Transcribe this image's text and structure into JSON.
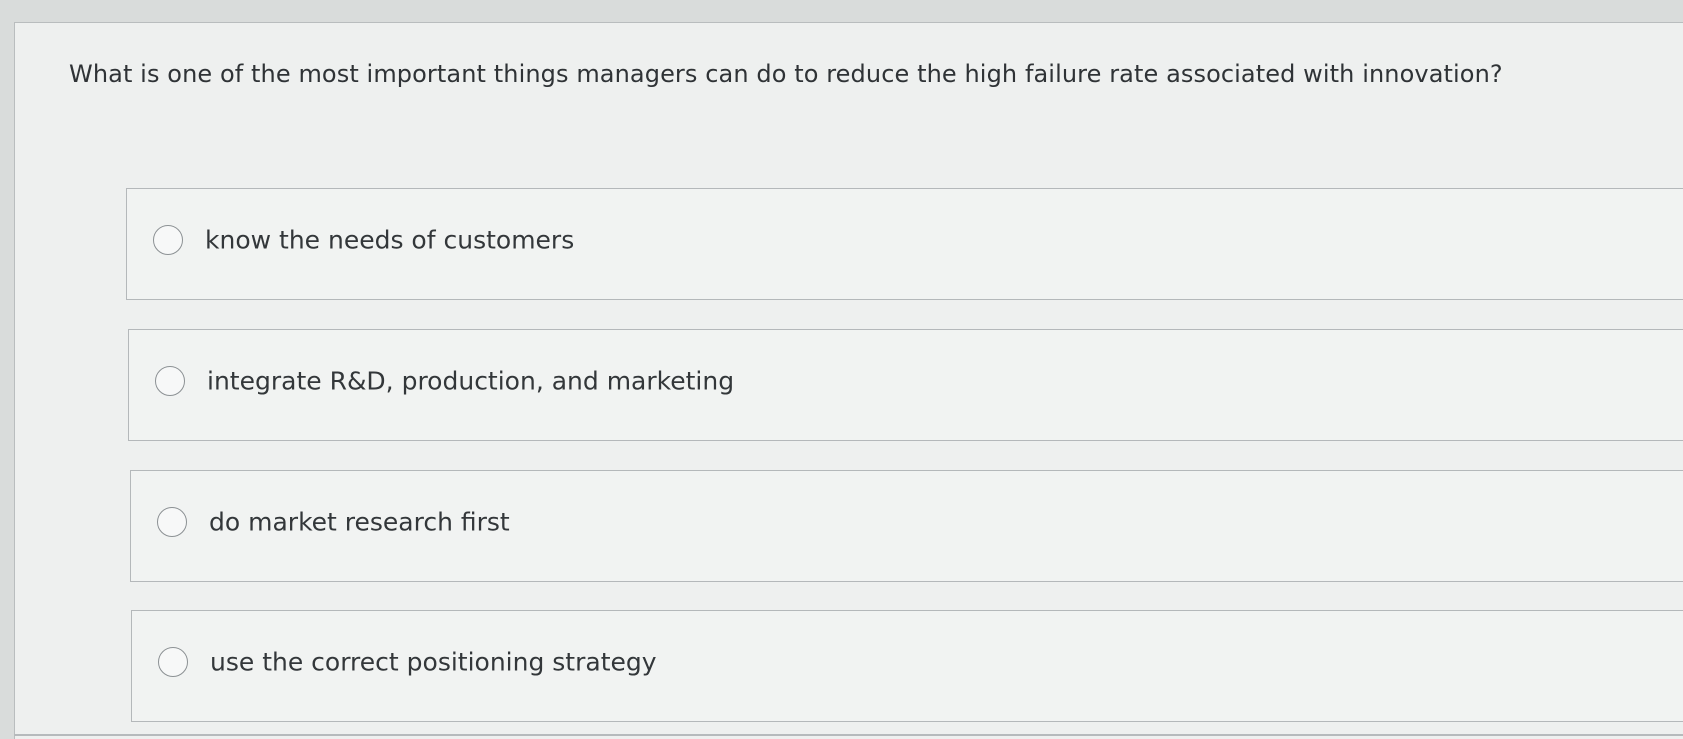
{
  "question": {
    "text": "What is one of the most important things managers can do to reduce the high failure rate associated with innovation?"
  },
  "options": [
    {
      "label": "know the needs of customers",
      "selected": false
    },
    {
      "label": "integrate R&D, production, and marketing",
      "selected": false
    },
    {
      "label": "do market research first",
      "selected": false
    },
    {
      "label": "use the correct positioning strategy",
      "selected": false
    }
  ],
  "colors": {
    "background": "#eef0ef",
    "border": "#b4b8ba",
    "text": "#33373a",
    "radio_border": "#8c9194"
  }
}
